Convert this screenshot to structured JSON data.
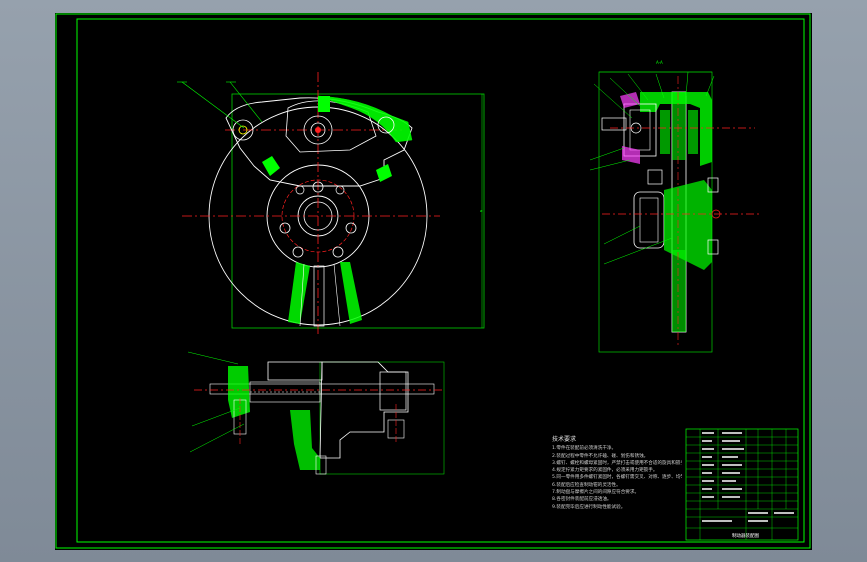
{
  "drawing": {
    "technical_requirements_title": "技术要求",
    "technical_requirements_lines": [
      "1.零件在装配前必须清洗干净。",
      "2.装配过程中零件不允许磕、碰、划伤和锈蚀。",
      "3.螺钉、螺栓和螺母紧固时，严禁打击或使用不合适的旋具和扳手。",
      "4.规定拧紧力矩要求的紧固件，必须采用力矩扳手。",
      "5.同一零件用多件螺钉紧固时，各螺钉需交叉、对称、逐步、均匀拧紧。",
      "6.装配后应检查制动钳的灵活性。",
      "7.制动盘与摩擦片之间的间隙应符合要求。",
      "8.各密封件装配前应浸透油。",
      "9.装配完毕后应进行制动性能试验。"
    ],
    "title_block_name": "制动器装配图",
    "section_marker": "A-A"
  },
  "colors": {
    "frame": "#00ff00",
    "outline": "#ffffff",
    "centerline": "#ff2020",
    "dimension": "#00e000",
    "hatch": "#00ff00",
    "yellow": "#ffff00",
    "magenta": "#ff40ff"
  }
}
